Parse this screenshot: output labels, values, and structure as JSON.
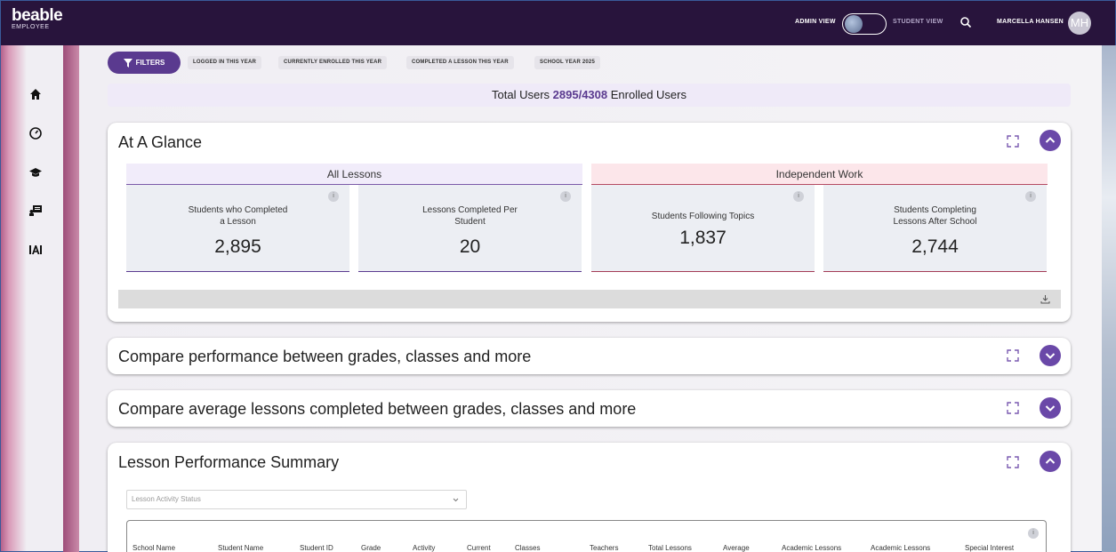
{
  "brand": {
    "name": "beable",
    "sub": "EMPLOYEE"
  },
  "header": {
    "admin_view": "ADMIN VIEW",
    "student_view": "STUDENT VIEW",
    "user_name": "MARCELLA HANSEN",
    "avatar_initials": "MH"
  },
  "filters": {
    "button_label": "FILTERS",
    "chips": [
      "LOGGED IN THIS YEAR",
      "CURRENTLY ENROLLED THIS YEAR",
      "COMPLETED A LESSON THIS YEAR",
      "SCHOOL YEAR 2025"
    ]
  },
  "totals": {
    "prefix": "Total Users",
    "value": "2895/4308",
    "suffix": "Enrolled Users"
  },
  "at_a_glance": {
    "title": "At A Glance",
    "sections": [
      "All Lessons",
      "Independent Work"
    ],
    "metrics": [
      {
        "label_1": "Students who Completed",
        "label_2": "a Lesson",
        "value": "2,895"
      },
      {
        "label_1": "Lessons Completed Per",
        "label_2": "Student",
        "value": "20"
      },
      {
        "label_1": "Students Following Topics",
        "label_2": "",
        "value": "1,837"
      },
      {
        "label_1": "Students Completing",
        "label_2": "Lessons After School",
        "value": "2,744"
      }
    ],
    "info_glyph": "i"
  },
  "cards": {
    "compare_performance": "Compare performance between grades, classes and more",
    "compare_average": "Compare average lessons completed between grades, classes and more",
    "lesson_summary": "Lesson Performance Summary"
  },
  "lesson_summary": {
    "select_placeholder": "Lesson Activity Status",
    "columns": [
      "School Name",
      "Student Name",
      "Student ID",
      "Grade",
      "Activity",
      "Current",
      "Classes",
      "Teachers",
      "Total Lessons",
      "Average",
      "Academic Lessons",
      "Academic Lessons",
      "Special Interest"
    ]
  },
  "colors": {
    "topbar": "#28143c",
    "accent_purple": "#5a3a8f",
    "accent_red": "#a33b56"
  }
}
